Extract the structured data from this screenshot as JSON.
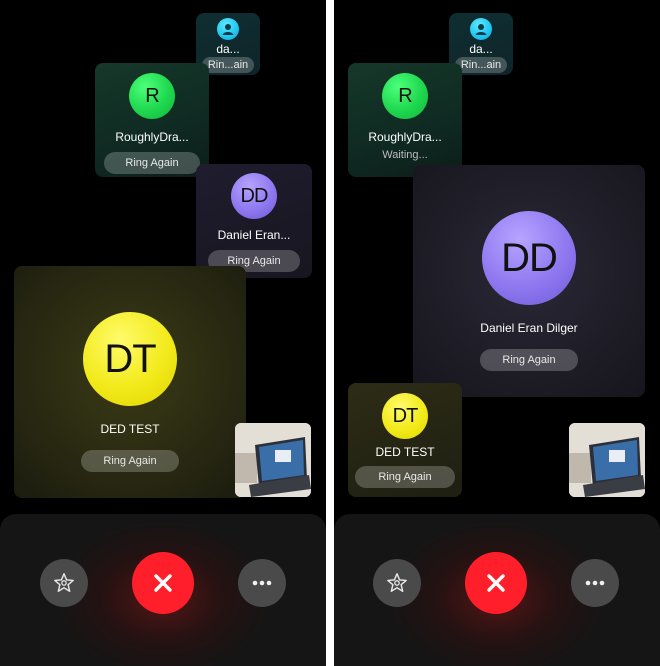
{
  "screens": [
    {
      "participants": [
        {
          "initials": "",
          "name": "da...",
          "button": "Rin...ain",
          "avatar_color": "#1ec6f0"
        },
        {
          "initials": "R",
          "name": "RoughlyDra...",
          "button": "Ring Again",
          "avatar_color": "#1fd84f"
        },
        {
          "initials": "DD",
          "name": "Daniel Eran...",
          "button": "Ring Again",
          "avatar_color": "#8f78f0"
        },
        {
          "initials": "DT",
          "name": "DED TEST",
          "button": "Ring Again",
          "avatar_color": "#f2ea1a"
        }
      ],
      "controls": {
        "effects_icon": "star-effects-icon",
        "end_icon": "close-icon",
        "more_icon": "ellipsis-icon"
      }
    },
    {
      "participants": [
        {
          "initials": "",
          "name": "da...",
          "button": "Rin...ain",
          "avatar_color": "#1ec6f0"
        },
        {
          "initials": "R",
          "name": "RoughlyDra...",
          "status": "Waiting...",
          "avatar_color": "#1fd84f"
        },
        {
          "initials": "DD",
          "name": "Daniel Eran Dilger",
          "button": "Ring Again",
          "avatar_color": "#8f78f0"
        },
        {
          "initials": "DT",
          "name": "DED TEST",
          "button": "Ring Again",
          "avatar_color": "#f2ea1a"
        }
      ],
      "controls": {
        "effects_icon": "star-effects-icon",
        "end_icon": "close-icon",
        "more_icon": "ellipsis-icon"
      }
    }
  ],
  "colors": {
    "end_call": "#ff1f2a",
    "background": "#000000"
  }
}
